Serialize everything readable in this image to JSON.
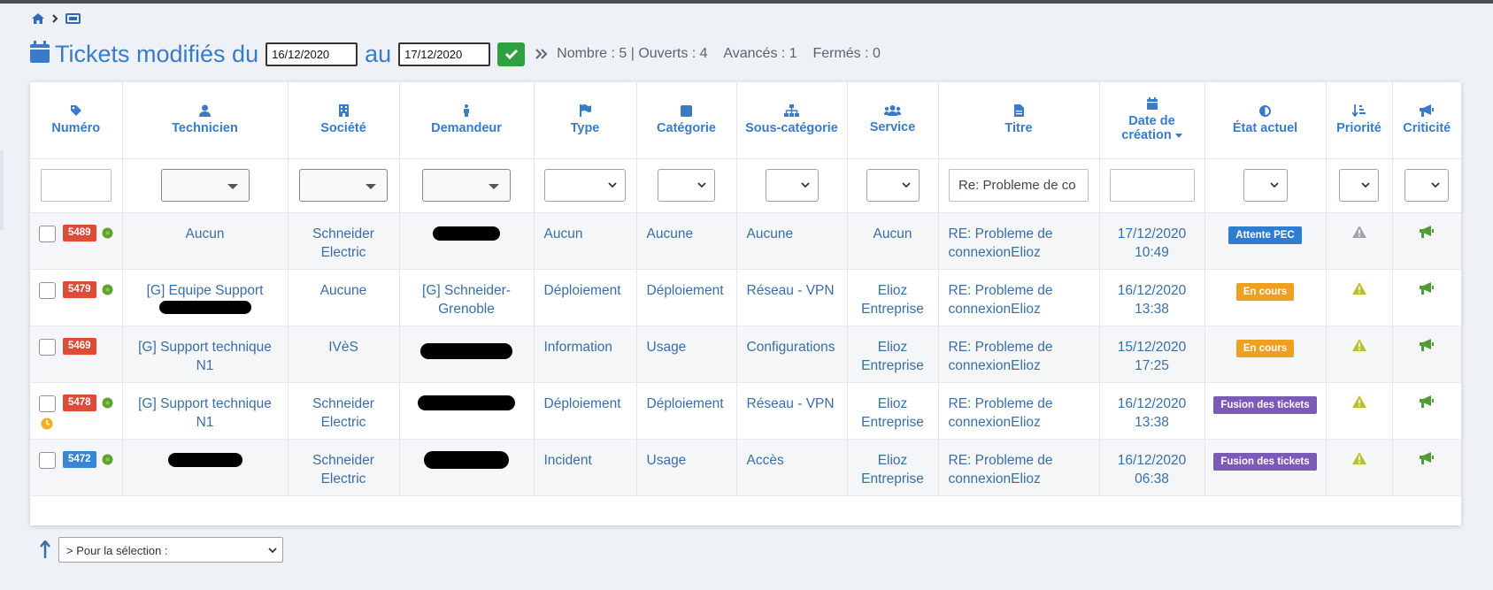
{
  "header": {
    "title": "Tickets modifiés du",
    "date_from": "16/12/2020",
    "au_label": "au",
    "date_to": "17/12/2020",
    "stats": {
      "nombre": "Nombre : 5 | Ouverts : 4",
      "avances": "Avancés : 1",
      "fermes": "Fermés : 0"
    }
  },
  "columns": [
    {
      "label": "Numéro",
      "icon": "tag-icon"
    },
    {
      "label": "Technicien",
      "icon": "user-icon"
    },
    {
      "label": "Société",
      "icon": "building-icon"
    },
    {
      "label": "Demandeur",
      "icon": "person-icon"
    },
    {
      "label": "Type",
      "icon": "flag-icon"
    },
    {
      "label": "Catégorie",
      "icon": "square-icon"
    },
    {
      "label": "Sous-catégorie",
      "icon": "sitemap-icon"
    },
    {
      "label": "Service",
      "icon": "users-icon"
    },
    {
      "label": "Titre",
      "icon": "file-icon"
    },
    {
      "label1": "Date de",
      "label2": "création",
      "icon": "calendar-icon"
    },
    {
      "label": "État actuel",
      "icon": "half-circle-icon"
    },
    {
      "label": "Priorité",
      "icon": "sort-icon"
    },
    {
      "label": "Criticité",
      "icon": "bullhorn-icon"
    }
  ],
  "filters": {
    "titre_value": "Re: Probleme de co"
  },
  "rows": [
    {
      "num": "5489",
      "num_color": "#dd4b39",
      "gear": true,
      "clock": false,
      "technicien": "Aucun",
      "societe1": "Schneider",
      "societe2": "Electric",
      "type": "Aucun",
      "categorie": "Aucune",
      "souscat": "Aucune",
      "service1": "Aucun",
      "service2": "",
      "titre1": "RE: Probleme de",
      "titre2": "connexionElioz",
      "date1": "17/12/2020",
      "date2": "10:49",
      "etat": "Attente PEC",
      "etat_color": "#2f7dd1",
      "prio_color": "#a0a4a8"
    },
    {
      "num": "5479",
      "num_color": "#dd4b39",
      "gear": true,
      "clock": false,
      "technicien": "[G] Equipe Support",
      "societe1": "Aucune",
      "societe2": "",
      "demandeur1": "[G] Schneider-",
      "demandeur2": "Grenoble",
      "type": "Déploiement",
      "categorie": "Déploiement",
      "souscat": "Réseau - VPN",
      "service1": "Elioz",
      "service2": "Entreprise",
      "titre1": "RE: Probleme de",
      "titre2": "connexionElioz",
      "date1": "16/12/2020",
      "date2": "13:38",
      "etat": "En cours",
      "etat_color": "#f0a020",
      "prio_color": "#b5c42b"
    },
    {
      "num": "5469",
      "num_color": "#dd4b39",
      "gear": false,
      "clock": false,
      "technicien1": "[G] Support technique",
      "technicien2": "N1",
      "societe1": "IVèS",
      "societe2": "",
      "type": "Information",
      "categorie": "Usage",
      "souscat": "Configurations",
      "service1": "Elioz",
      "service2": "Entreprise",
      "titre1": "RE: Probleme de",
      "titre2": "connexionElioz",
      "date1": "15/12/2020",
      "date2": "17:25",
      "etat": "En cours",
      "etat_color": "#f0a020",
      "prio_color": "#b5c42b"
    },
    {
      "num": "5478",
      "num_color": "#dd4b39",
      "gear": true,
      "clock": true,
      "technicien1": "[G] Support technique",
      "technicien2": "N1",
      "societe1": "Schneider",
      "societe2": "Electric",
      "type": "Déploiement",
      "categorie": "Déploiement",
      "souscat": "Réseau - VPN",
      "service1": "Elioz",
      "service2": "Entreprise",
      "titre1": "RE: Probleme de",
      "titre2": "connexionElioz",
      "date1": "16/12/2020",
      "date2": "13:38",
      "etat": "Fusion des tickets",
      "etat_color": "#7a5bb5",
      "prio_color": "#b5c42b"
    },
    {
      "num": "5472",
      "num_color": "#3b86d4",
      "gear": true,
      "clock": false,
      "societe1": "Schneider",
      "societe2": "Electric",
      "type": "Incident",
      "categorie": "Usage",
      "souscat": "Accès",
      "service1": "Elioz",
      "service2": "Entreprise",
      "titre1": "RE: Probleme de",
      "titre2": "connexionElioz",
      "date1": "16/12/2020",
      "date2": "06:38",
      "etat": "Fusion des tickets",
      "etat_color": "#7a5bb5",
      "prio_color": "#b5c42b"
    }
  ],
  "bulk": {
    "selected": "> Pour la sélection :"
  },
  "colors": {
    "accent": "#3a7bc8",
    "ok_green": "#2fa042",
    "gear_green": "#5fa32f",
    "criticite_green": "#4f9a3a"
  }
}
